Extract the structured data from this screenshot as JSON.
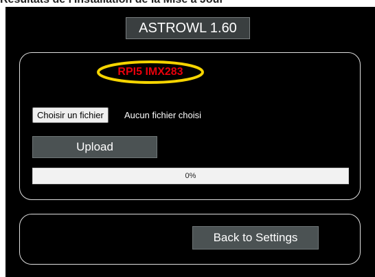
{
  "header": {
    "partial_text": "Résultats de l'Installation de la Mise à Jour",
    "title": "ASTROWL 1.60"
  },
  "upload_panel": {
    "device_label": "RPI5 IMX283",
    "file_button_label": "Choisir un fichier",
    "file_status": "Aucun fichier choisi",
    "upload_button_label": "Upload",
    "progress_fraction": 0,
    "progress_text": "0%"
  },
  "back_panel": {
    "back_button_label": "Back to Settings"
  },
  "colors": {
    "background": "#000000",
    "button": "#4b5253",
    "device_label": "#e8000b",
    "highlight_ellipse": "#f5d400"
  }
}
